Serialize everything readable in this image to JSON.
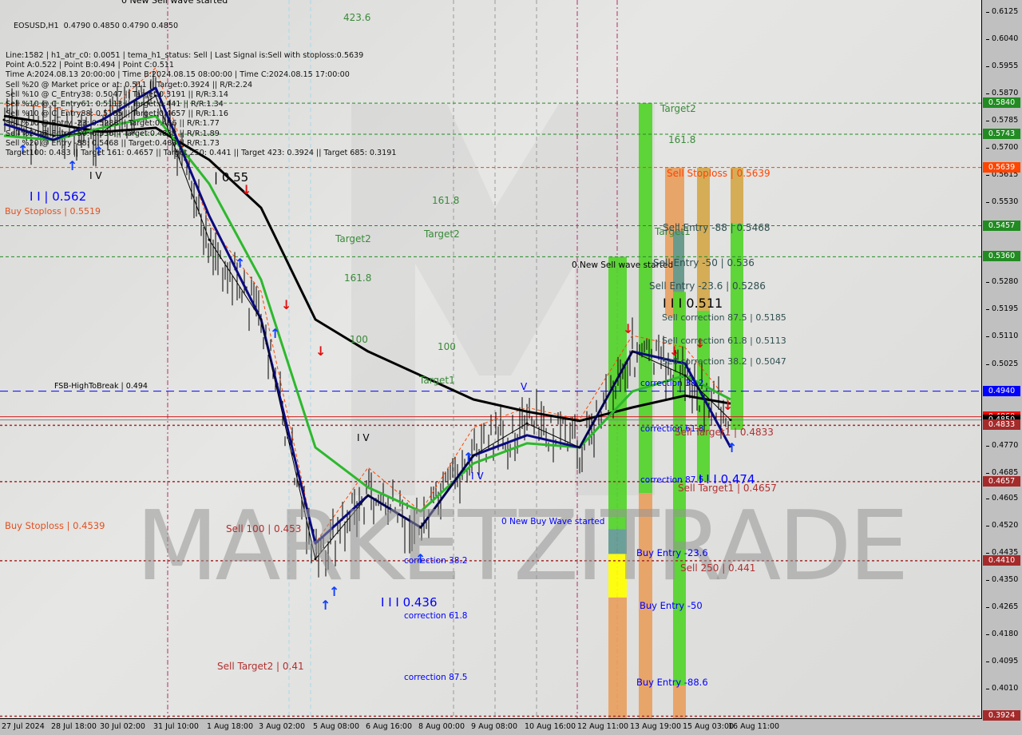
{
  "info": {
    "symbol_line": "EOSUSD,H1  0.4790 0.4850 0.4790 0.4850",
    "lines": [
      "Line:1582 | h1_atr_c0: 0.0051 | tema_h1_status: Sell | Last Signal is:Sell with stoploss:0.5639",
      "Point A:0.522 | Point B:0.494 | Point C:0.511",
      "Time A:2024.08.13 20:00:00 | Time B:2024.08.15 08:00:00 | Time C:2024.08.15 17:00:00",
      "Sell %20 @ Market price or at: 0.511 || Target:0.3924 || R/R:2.24",
      "Sell %10 @ C_Entry38: 0.5047 || Target:0.3191 || R/R:3.14",
      "Sell %10 @ C_Entry61: 0.5113 || Target:0.441 || R/R:1.34",
      "Sell %10 @ C_Entry88: 0.5185 || Target:0.4657 || R/R:1.16",
      "Sell %10 @ Entry -23: 0.5286 || Target:0.466 || R/R:1.77",
      "Sell %20 @ Entry -50: 0.536 || Target:0.4833 || R/R:1.89",
      "Sell %20 @ Entry -88: 0.5468 || Target:0.483 || R/R:1.73",
      "Target100: 0.483 || Target 161: 0.4657 || Target 250: 0.441 || Target 423: 0.3924 || Target 685: 0.3191"
    ]
  },
  "watermark": "MARKETZITRADE",
  "colors": {
    "green_level": "#228b22",
    "stoploss": "#ff4500",
    "blue_level": "#0000ff",
    "red_level": "#a52a2a",
    "ma_slow": "#000000",
    "ma_mid": "#2db82d",
    "ma_fast": "#0a0a80",
    "zone_green": "#52d42a",
    "zone_orange": "#e8a060",
    "zone_gold": "#d4a84a",
    "zone_yellow": "#ffff00",
    "zone_teal": "#5f9a90"
  },
  "chart_data": {
    "type": "line",
    "title": "EOSUSD,H1",
    "x_ticks": [
      "27 Jul 2024",
      "28 Jul 18:00",
      "30 Jul 02:00",
      "31 Jul 10:00",
      "1 Aug 18:00",
      "3 Aug 02:00",
      "5 Aug 08:00",
      "6 Aug 16:00",
      "8 Aug 00:00",
      "9 Aug 08:00",
      "10 Aug 16:00",
      "12 Aug 11:00",
      "13 Aug 19:00",
      "15 Aug 03:00",
      "16 Aug 11:00"
    ],
    "y_ticks": [
      "0.6125",
      "0.6040",
      "0.5955",
      "0.5870",
      "0.5785",
      "0.5700",
      "0.5615",
      "0.5530",
      "0.5445",
      "0.5280",
      "0.5195",
      "0.5110",
      "0.5025",
      "0.4770",
      "0.4685",
      "0.4605",
      "0.4520",
      "0.4435",
      "0.4350",
      "0.4265",
      "0.4180",
      "0.4095",
      "0.4010"
    ],
    "ylim": [
      0.39,
      0.6185
    ],
    "series": [
      {
        "key": "price",
        "values": [
          0.5788,
          0.5738,
          0.575,
          0.5863,
          0.5413,
          0.5164,
          0.4415,
          0.4614,
          0.4514,
          0.4739,
          0.4839,
          0.4764,
          0.5064,
          0.4989,
          0.485
        ]
      },
      {
        "key": "ma_slow",
        "values": [
          0.58,
          0.5775,
          0.575,
          0.5763,
          0.5663,
          0.5513,
          0.5164,
          0.5064,
          0.4989,
          0.4914,
          0.4876,
          0.4847,
          0.4889,
          0.4926,
          0.4901
        ]
      },
      {
        "key": "ma_mid",
        "values": [
          0.5738,
          0.5725,
          0.5763,
          0.58,
          0.5588,
          0.5288,
          0.4764,
          0.4639,
          0.4564,
          0.4714,
          0.4777,
          0.4764,
          0.4939,
          0.4989,
          0.4914
        ]
      },
      {
        "key": "ma_fast",
        "values": [
          0.5775,
          0.5725,
          0.5788,
          0.5888,
          0.5488,
          0.5164,
          0.4464,
          0.4614,
          0.4514,
          0.4739,
          0.4802,
          0.4764,
          0.5064,
          0.5026,
          0.4764
        ]
      }
    ],
    "levels": [
      {
        "price": "0.5840",
        "style": "green"
      },
      {
        "price": "0.5743",
        "style": "green"
      },
      {
        "price": "0.5639",
        "style": "stoploss"
      },
      {
        "price": "0.5457",
        "style": "green"
      },
      {
        "price": "0.5360",
        "style": "green"
      },
      {
        "price": "0.4940",
        "style": "blue"
      },
      {
        "price": "0.4860",
        "style": "current-red"
      },
      {
        "price": "0.4850",
        "style": "current"
      },
      {
        "price": "0.4833",
        "style": "red"
      },
      {
        "price": "0.4657",
        "style": "red"
      },
      {
        "price": "0.4410",
        "style": "red"
      },
      {
        "price": "0.3924",
        "style": "red"
      }
    ],
    "annotations": [
      {
        "text": "0 New Sell wave started",
        "color": "#000000"
      },
      {
        "text": "423.6",
        "color": "#3a8a3a"
      },
      {
        "text": "| 0.55",
        "color": "#000000"
      },
      {
        "text": "I I | 0.562",
        "color": "#0000ff"
      },
      {
        "text": "Buy Stoploss | 0.5519",
        "color": "#e05020"
      },
      {
        "text": "I V",
        "color": "#000000"
      },
      {
        "text": "Target2",
        "color": "#3a8a3a"
      },
      {
        "text": "161.8",
        "color": "#3a8a3a"
      },
      {
        "text": "161.8",
        "color": "#3a8a3a"
      },
      {
        "text": "Target2",
        "color": "#3a8a3a"
      },
      {
        "text": "100",
        "color": "#3a8a3a"
      },
      {
        "text": "100",
        "color": "#3a8a3a"
      },
      {
        "text": "Target1",
        "color": "#3a8a3a"
      },
      {
        "text": "FSB-HighToBreak | 0.494",
        "color": "#000000"
      },
      {
        "text": "I V",
        "color": "#000000"
      },
      {
        "text": "V",
        "color": "#0000ff"
      },
      {
        "text": "I V",
        "color": "#0000ff"
      },
      {
        "text": "Buy Stoploss | 0.4539",
        "color": "#e05020"
      },
      {
        "text": "Sell 100 | 0.453",
        "color": "#b03030"
      },
      {
        "text": "0 New Buy Wave started",
        "color": "#0000ff"
      },
      {
        "text": "correction 38.2",
        "color": "#0000ff"
      },
      {
        "text": "I I I 0.436",
        "color": "#0000ff"
      },
      {
        "text": "correction 61.8",
        "color": "#0000ff"
      },
      {
        "text": "correction 87.5",
        "color": "#0000ff"
      },
      {
        "text": "Sell Target2 | 0.41",
        "color": "#b03030"
      },
      {
        "text": "Target2",
        "color": "#3a8a3a"
      },
      {
        "text": "161.8",
        "color": "#3a8a3a"
      },
      {
        "text": "Sell Stoploss | 0.5639",
        "color": "#ff4500"
      },
      {
        "text": "Target1",
        "color": "#3a8a3a"
      },
      {
        "text": "Sell Entry -88 | 0.5468",
        "color": "#2f4f4f"
      },
      {
        "text": "0.New Sell wave started",
        "color": "#000000"
      },
      {
        "text": "Sell Entry -50 | 0.536",
        "color": "#2f4f4f"
      },
      {
        "text": "Sell Entry -23.6 | 0.5286",
        "color": "#2f4f4f"
      },
      {
        "text": "I I I 0.511",
        "color": "#000000"
      },
      {
        "text": "Sell correction 87.5 | 0.5185",
        "color": "#2f4f4f"
      },
      {
        "text": "Sell correction 61.8 | 0.5113",
        "color": "#2f4f4f"
      },
      {
        "text": "Sell correction 38.2 | 0.5047",
        "color": "#2f4f4f"
      },
      {
        "text": "correction 38.2",
        "color": "#0000ff"
      },
      {
        "text": "correction 61.8",
        "color": "#0000ff"
      },
      {
        "text": "Sell Target1 | 0.4833",
        "color": "#b03030"
      },
      {
        "text": "correction 87.5",
        "color": "#0000ff"
      },
      {
        "text": "I I I 0.474",
        "color": "#0000ff"
      },
      {
        "text": "Sell Target1 | 0.4657",
        "color": "#b03030"
      },
      {
        "text": "Buy Entry -23.6",
        "color": "#0000ff"
      },
      {
        "text": "Sell 250 | 0.441",
        "color": "#b03030"
      },
      {
        "text": "Buy Entry -50",
        "color": "#0000ff"
      },
      {
        "text": "Buy Entry -88.6",
        "color": "#0000ff"
      }
    ]
  }
}
